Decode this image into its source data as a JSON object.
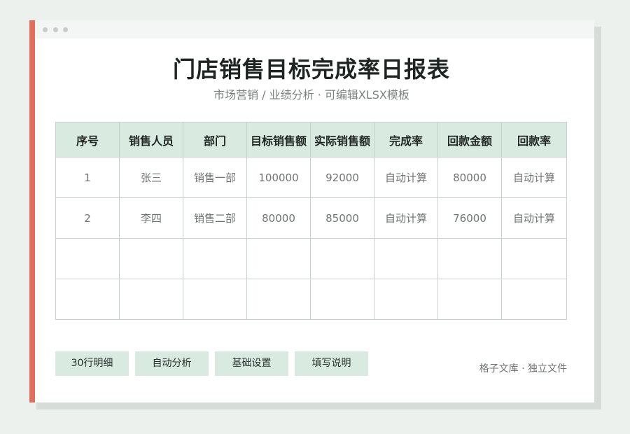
{
  "header": {
    "title": "门店销售目标完成率日报表",
    "subtitle": "市场营销 / 业绩分析 · 可编辑XLSX模板"
  },
  "table": {
    "columns": [
      "序号",
      "销售人员",
      "部门",
      "目标销售额",
      "实际销售额",
      "完成率",
      "回款金额",
      "回款率"
    ],
    "rows": [
      [
        "1",
        "张三",
        "销售一部",
        "100000",
        "92000",
        "自动计算",
        "80000",
        "自动计算"
      ],
      [
        "2",
        "李四",
        "销售二部",
        "80000",
        "85000",
        "自动计算",
        "76000",
        "自动计算"
      ],
      [
        "",
        "",
        "",
        "",
        "",
        "",
        "",
        ""
      ],
      [
        "",
        "",
        "",
        "",
        "",
        "",
        "",
        ""
      ]
    ]
  },
  "buttons": {
    "details": "30行明细",
    "analysis": "自动分析",
    "settings": "基础设置",
    "instructions": "填写说明"
  },
  "footer": {
    "text": "格子文库 · 独立文件"
  },
  "colors": {
    "accent": "#e06f5f",
    "header_fill": "#d9ebe1",
    "background": "#edf1ee"
  }
}
